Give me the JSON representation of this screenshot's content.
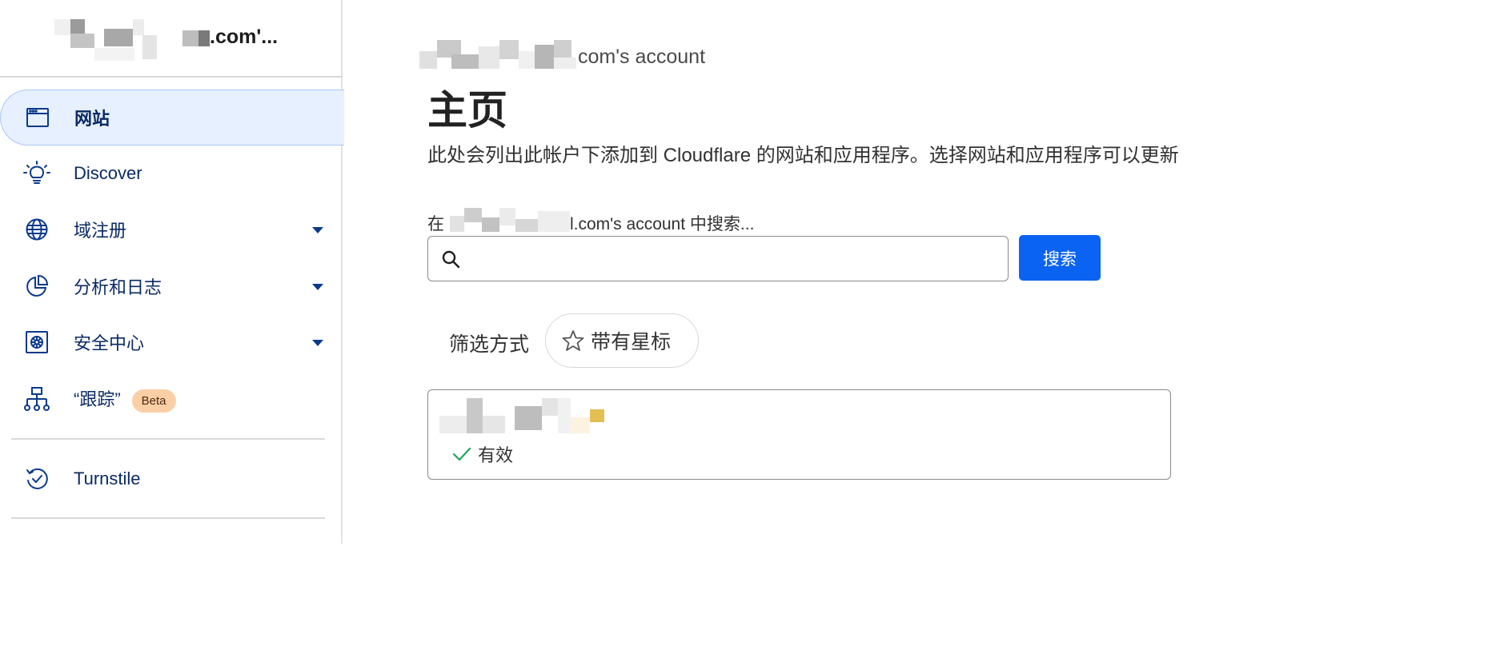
{
  "sidebar": {
    "account_name": ".com'...",
    "items": [
      {
        "label": "网站",
        "icon": "browser-window-icon",
        "active": true
      },
      {
        "label": "Discover",
        "icon": "lightbulb-icon"
      },
      {
        "label": "域注册",
        "icon": "globe-icon",
        "expandable": true
      },
      {
        "label": "分析和日志",
        "icon": "pie-chart-icon",
        "expandable": true
      },
      {
        "label": "安全中心",
        "icon": "vault-icon",
        "expandable": true
      },
      {
        "label": "“跟踪”",
        "icon": "network-icon",
        "badge": "Beta"
      },
      {
        "label": "Turnstile",
        "icon": "turnstile-icon"
      }
    ]
  },
  "main": {
    "account_label": "com's account",
    "title": "主页",
    "description": "此处会列出此帐户下添加到 Cloudflare 的网站和应用程序。选择网站和应用程序可以更新",
    "search": {
      "label_prefix": "在",
      "label_suffix": "l.com's account 中搜索...",
      "value": "",
      "button_label": "搜索"
    },
    "filter": {
      "label": "筛选方式",
      "chip_label": "带有星标"
    },
    "sites": [
      {
        "status": "有效"
      }
    ]
  },
  "colors": {
    "accent": "#0a63f2",
    "nav_text": "#0a2a64",
    "active_bg": "#e6f0ff",
    "beta_bg": "#fbcfa6",
    "status_ok": "#1fa65a"
  }
}
